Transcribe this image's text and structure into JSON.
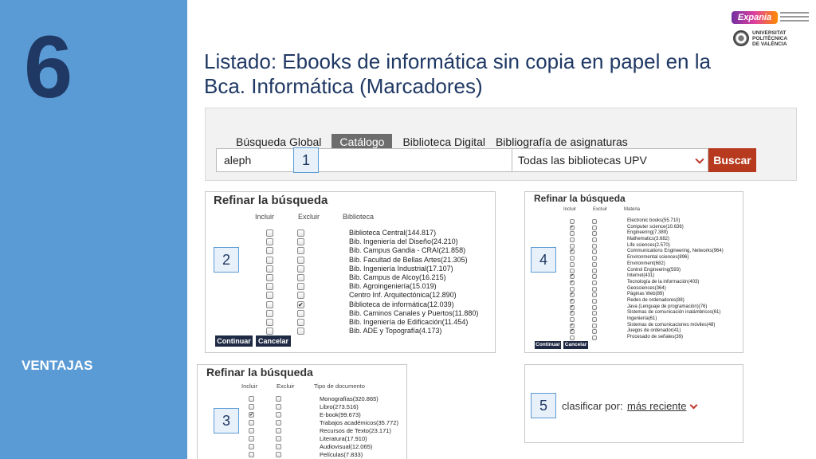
{
  "slide": {
    "number": "6",
    "section": "VENTAJAS",
    "title": "Listado: Ebooks de informática sin copia en papel en la Bca. Informática (Marcadores)"
  },
  "logos": {
    "expania": "Expania",
    "upv_lines": [
      "UNIVERSITAT",
      "POLITÈCNICA",
      "DE VALÈNCIA"
    ]
  },
  "search": {
    "tabs": [
      "Búsqueda Global",
      "Catálogo",
      "Biblioteca Digital",
      "Bibliografía de asignaturas"
    ],
    "active_tab": "Catálogo",
    "query": "aleph",
    "library": "Todas las bibliotecas UPV",
    "button": "Buscar"
  },
  "badges": [
    "1",
    "2",
    "3",
    "4",
    "5"
  ],
  "refine_library": {
    "title": "Refinar la búsqueda",
    "columns": [
      "Incluir",
      "Excluir",
      "Biblioteca"
    ],
    "rows": [
      {
        "label": "Biblioteca Central(144.817)",
        "include": false,
        "exclude": false
      },
      {
        "label": "Bib. Ingeniería del Diseño(24.210)",
        "include": false,
        "exclude": false
      },
      {
        "label": "Bib. Campus Gandia - CRAI(21.858)",
        "include": false,
        "exclude": false
      },
      {
        "label": "Bib. Facultad de Bellas Artes(21.305)",
        "include": false,
        "exclude": false
      },
      {
        "label": "Bib. Ingeniería Industrial(17.107)",
        "include": false,
        "exclude": false
      },
      {
        "label": "Bib. Campus de Alcoy(16.215)",
        "include": false,
        "exclude": false
      },
      {
        "label": "Bib. Agroingeniería(15.019)",
        "include": false,
        "exclude": false
      },
      {
        "label": "Centro Inf. Arquitectónica(12.890)",
        "include": false,
        "exclude": false
      },
      {
        "label": "Biblioteca de informática(12.039)",
        "include": false,
        "exclude": true
      },
      {
        "label": "Bib. Caminos Canales y Puertos(11.880)",
        "include": false,
        "exclude": false
      },
      {
        "label": "Bib. Ingeniería de Edificación(11.454)",
        "include": false,
        "exclude": false
      },
      {
        "label": "Bib. ADE y Topografía(4.173)",
        "include": false,
        "exclude": false
      }
    ],
    "continue": "Continuar",
    "cancel": "Cancelar"
  },
  "refine_subject": {
    "title": "Refinar la búsqueda",
    "columns": [
      "Incluir",
      "Excluir",
      "Materia"
    ],
    "rows": [
      {
        "label": "Electronic books(55.710)",
        "include": false,
        "exclude": false
      },
      {
        "label": "Computer science(10.636)",
        "include": true,
        "exclude": false
      },
      {
        "label": "Engineering(7.389)",
        "include": false,
        "exclude": false
      },
      {
        "label": "Mathematics(3.682)",
        "include": false,
        "exclude": false
      },
      {
        "label": "Life sciences(2.570)",
        "include": false,
        "exclude": false
      },
      {
        "label": "Communications Engineering, Networks(964)",
        "include": true,
        "exclude": false
      },
      {
        "label": "Environmental sciences(896)",
        "include": false,
        "exclude": false
      },
      {
        "label": "Environment(682)",
        "include": false,
        "exclude": false
      },
      {
        "label": "Control Engineering(593)",
        "include": false,
        "exclude": false
      },
      {
        "label": "Internet(431)",
        "include": true,
        "exclude": false
      },
      {
        "label": "Tecnología de la información(403)",
        "include": true,
        "exclude": false
      },
      {
        "label": "Geosciences(364)",
        "include": false,
        "exclude": false
      },
      {
        "label": "Páginas Web(89)",
        "include": true,
        "exclude": false
      },
      {
        "label": "Redes de ordenadores(88)",
        "include": true,
        "exclude": false
      },
      {
        "label": "Java (Lenguaje de programación)(76)",
        "include": true,
        "exclude": false
      },
      {
        "label": "Sistemas de comunicación inalámbricos(61)",
        "include": true,
        "exclude": false
      },
      {
        "label": "Ingeniería(61)",
        "include": false,
        "exclude": false
      },
      {
        "label": "Sistemas de comunicaciones móviles(48)",
        "include": true,
        "exclude": false
      },
      {
        "label": "Juegos de ordenador(41)",
        "include": true,
        "exclude": false
      },
      {
        "label": "Procesado de señales(39)",
        "include": false,
        "exclude": false
      }
    ],
    "continue": "Continuar",
    "cancel": "Cancelar"
  },
  "refine_doctype": {
    "title": "Refinar la búsqueda",
    "columns": [
      "Incluir",
      "Excluir",
      "Tipo de documento"
    ],
    "rows": [
      {
        "label": "Monografías(320.865)",
        "include": false,
        "exclude": false
      },
      {
        "label": "Libro(273.516)",
        "include": false,
        "exclude": false
      },
      {
        "label": "E-book(99.673)",
        "include": true,
        "exclude": false
      },
      {
        "label": "Trabajos académicos(35.772)",
        "include": false,
        "exclude": false
      },
      {
        "label": "Recursos de Texto(23.171)",
        "include": false,
        "exclude": false
      },
      {
        "label": "Literatura(17.910)",
        "include": false,
        "exclude": false
      },
      {
        "label": "Audiovisual(12.065)",
        "include": false,
        "exclude": false
      },
      {
        "label": "Películas(7.833)",
        "include": false,
        "exclude": false
      }
    ]
  },
  "sort": {
    "label": "clasificar por:",
    "value": "más reciente"
  }
}
